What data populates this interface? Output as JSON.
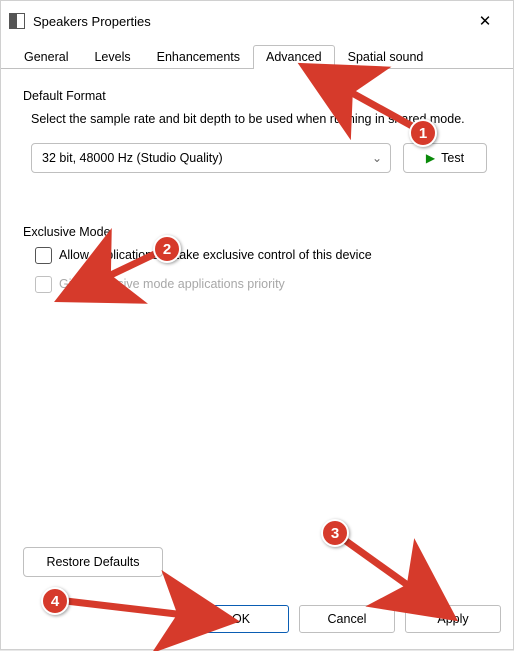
{
  "window": {
    "title": "Speakers Properties"
  },
  "tabs": {
    "general": "General",
    "levels": "Levels",
    "enhancements": "Enhancements",
    "advanced": "Advanced",
    "spatial": "Spatial sound",
    "active": "advanced"
  },
  "default_format": {
    "section_label": "Default Format",
    "description": "Select the sample rate and bit depth to be used when running in shared mode.",
    "selected": "32 bit, 48000 Hz (Studio Quality)",
    "test_label": "Test"
  },
  "exclusive_mode": {
    "section_label": "Exclusive Mode",
    "opt_allow": "Allow applications to take exclusive control of this device",
    "opt_priority": "Give exclusive mode applications priority",
    "allow_checked": false,
    "priority_checked": false,
    "priority_disabled": true
  },
  "restore_label": "Restore Defaults",
  "buttons": {
    "ok": "OK",
    "cancel": "Cancel",
    "apply": "Apply"
  },
  "annotations": {
    "m1": "1",
    "m2": "2",
    "m3": "3",
    "m4": "4"
  }
}
